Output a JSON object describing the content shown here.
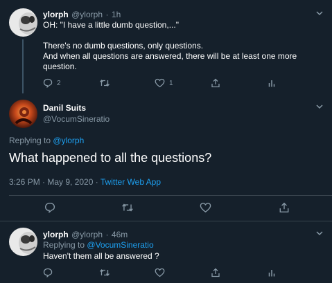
{
  "tweet1": {
    "name": "ylorph",
    "handle": "@ylorph",
    "dot": "·",
    "time": "1h",
    "line1": "OH: \"I have a little dumb question,...\"",
    "line2": "There's no dumb questions, only questions.",
    "line3": "And when all questions are answered, there will be at least one more",
    "line4": "question.",
    "reply_count": "2",
    "like_count": "1"
  },
  "main": {
    "name": "Danil Suits",
    "handle": "@VocumSineratio",
    "replying_label": "Replying to",
    "replying_handle": "@ylorph",
    "text": "What happened to all the questions?",
    "meta_time": "3:26 PM · May 9, 2020 ·",
    "meta_source": "Twitter Web App"
  },
  "tweet3": {
    "name": "ylorph",
    "handle": "@ylorph",
    "dot": "·",
    "time": "46m",
    "replying_label": "Replying to",
    "replying_handle": "@VocumSineratio",
    "text": "Haven't them all be answered ?"
  },
  "colors": {
    "background": "#15202b",
    "muted": "#8899a6",
    "accent": "#1da1f2",
    "divider": "#38444d"
  },
  "icons": [
    "chevron-down-icon",
    "reply-icon",
    "retweet-icon",
    "like-icon",
    "share-icon",
    "analytics-icon"
  ]
}
